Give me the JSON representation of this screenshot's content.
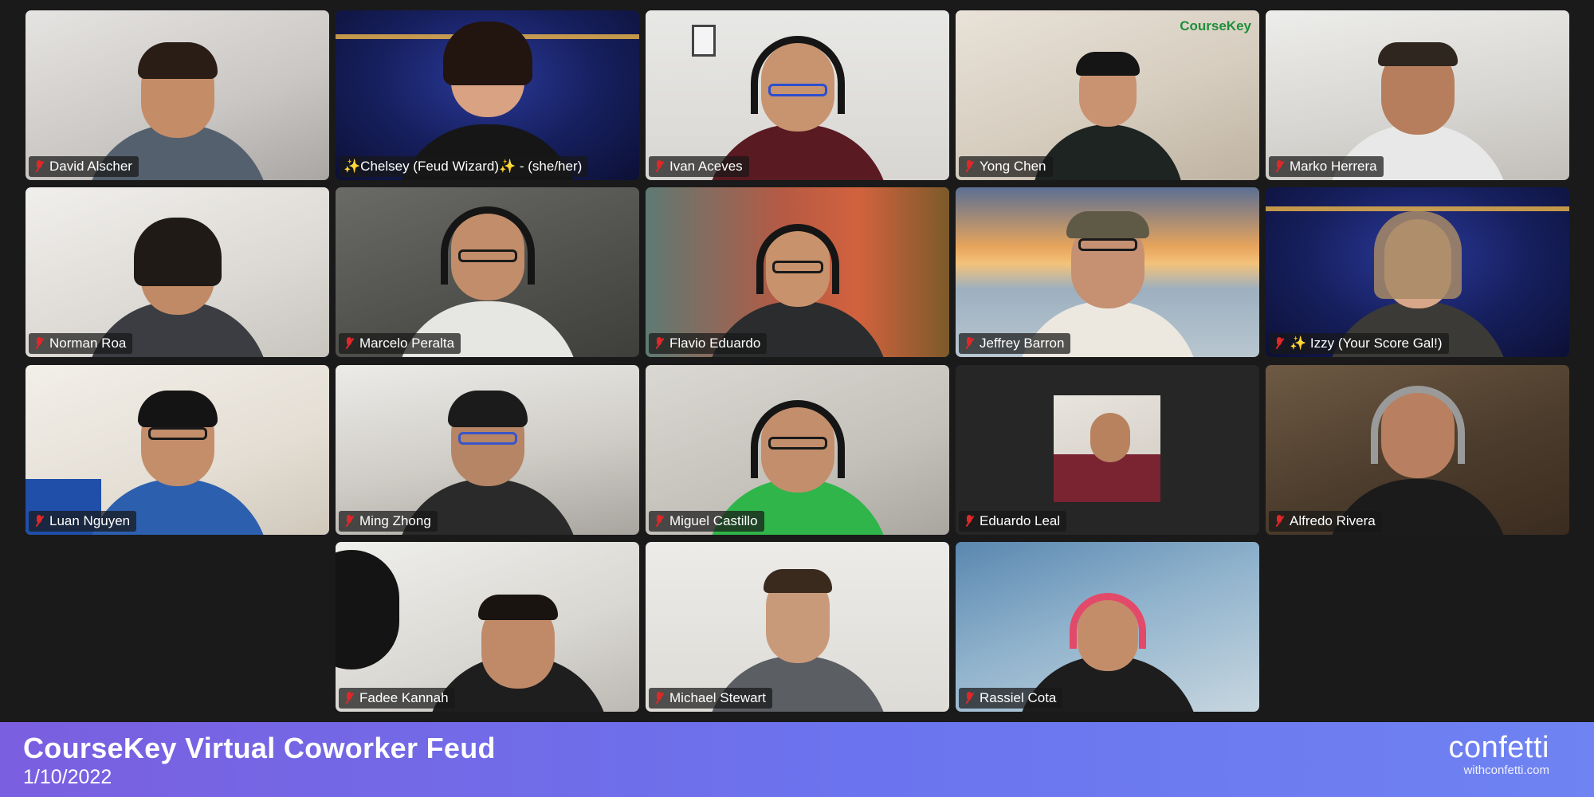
{
  "participants": [
    {
      "name": "David Alscher"
    },
    {
      "name": "✨Chelsey (Feud Wizard)✨ - (she/her)"
    },
    {
      "name": "Ivan Aceves"
    },
    {
      "name": "Yong Chen"
    },
    {
      "name": "Marko Herrera"
    },
    {
      "name": "Norman Roa"
    },
    {
      "name": "Marcelo Peralta"
    },
    {
      "name": "Flavio Eduardo",
      "active_speaker": true
    },
    {
      "name": "Jeffrey Barron"
    },
    {
      "name": "✨ Izzy (Your Score Gal!)"
    },
    {
      "name": "Luan Nguyen"
    },
    {
      "name": "Ming Zhong"
    },
    {
      "name": "Miguel Castillo"
    },
    {
      "name": "Eduardo Leal"
    },
    {
      "name": "Alfredo Rivera"
    },
    {
      "name": "Fadee Kannah"
    },
    {
      "name": "Michael Stewart"
    },
    {
      "name": "Rassiel Cota"
    }
  ],
  "background_brand": "CourseKey",
  "banner": {
    "title": "CourseKey Virtual Coworker Feud",
    "date": "1/10/2022",
    "brand_name": "confetti",
    "brand_url": "withconfetti.com"
  },
  "colors": {
    "active_speaker_border": "#2fcf4a",
    "muted_mic": "#e02828",
    "banner_start": "#7a5fe0",
    "banner_end": "#6f83f2",
    "background": "#1a1a1a"
  },
  "icons": {
    "mic_status": "muted-mic-icon"
  }
}
